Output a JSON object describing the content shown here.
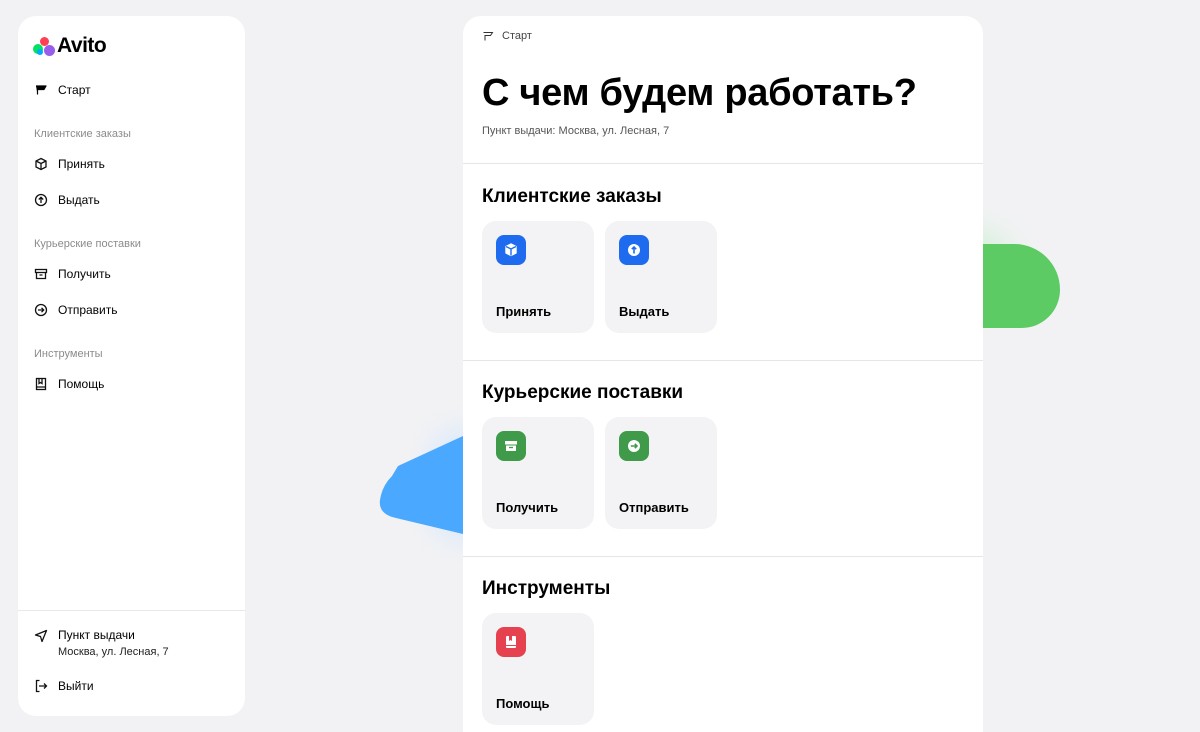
{
  "brand": {
    "name": "Avito"
  },
  "sidebar": {
    "start": {
      "label": "Старт",
      "icon": "flag-icon"
    },
    "sections": [
      {
        "title": "Клиентские заказы",
        "items": [
          {
            "label": "Принять",
            "icon": "box-icon"
          },
          {
            "label": "Выдать",
            "icon": "arrow-up-circle-icon"
          }
        ]
      },
      {
        "title": "Курьерские поставки",
        "items": [
          {
            "label": "Получить",
            "icon": "archive-icon"
          },
          {
            "label": "Отправить",
            "icon": "arrow-right-circle-icon"
          }
        ]
      },
      {
        "title": "Инструменты",
        "items": [
          {
            "label": "Помощь",
            "icon": "book-icon"
          }
        ]
      }
    ],
    "pickup": {
      "title": "Пункт выдачи",
      "address": "Москва, ул. Лесная, 7",
      "icon": "navigation-icon"
    },
    "logout": {
      "label": "Выйти",
      "icon": "logout-icon"
    }
  },
  "main": {
    "breadcrumb": "Старт",
    "title": "С чем будем работать?",
    "subtitle": "Пункт выдачи: Москва, ул. Лесная, 7",
    "sections": [
      {
        "title": "Клиентские заказы",
        "tiles": [
          {
            "label": "Принять",
            "icon": "box-icon",
            "color": "#1e6bf0"
          },
          {
            "label": "Выдать",
            "icon": "arrow-up-circle-icon",
            "color": "#1e6bf0"
          }
        ]
      },
      {
        "title": "Курьерские поставки",
        "tiles": [
          {
            "label": "Получить",
            "icon": "archive-icon",
            "color": "#3f9a4a"
          },
          {
            "label": "Отправить",
            "icon": "arrow-right-circle-icon",
            "color": "#3f9a4a"
          }
        ]
      },
      {
        "title": "Инструменты",
        "tiles": [
          {
            "label": "Помощь",
            "icon": "book-icon",
            "color": "#e6414f"
          }
        ]
      }
    ]
  },
  "colors": {
    "background": "#f2f2f4",
    "blue": "#1e6bf0",
    "green": "#3f9a4a",
    "red": "#e6414f",
    "deco_green": "#5ccb64",
    "deco_blue": "#4aa8ff"
  }
}
